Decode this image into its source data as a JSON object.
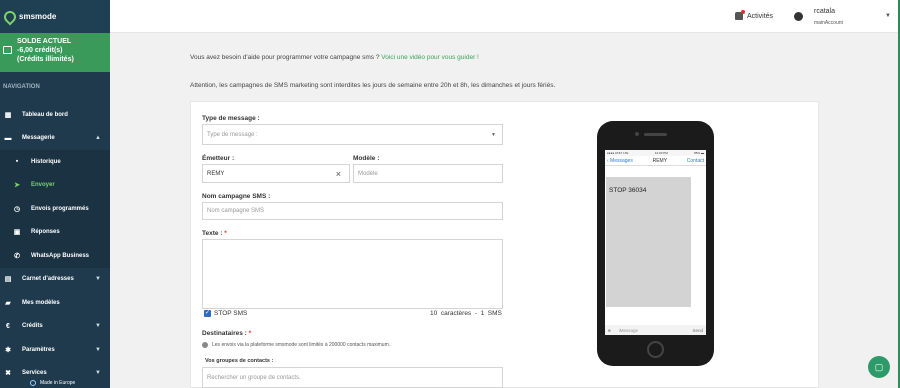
{
  "brand": {
    "name": "smsmode"
  },
  "balance": {
    "title": "SOLDE ACTUEL",
    "amount": "-6,00 crédit(s)",
    "note": "(Crédits illimités)"
  },
  "nav": {
    "heading": "NAVIGATION",
    "items": [
      {
        "label": "Tableau de bord",
        "icon": "dashboard-icon"
      },
      {
        "label": "Messagerie",
        "icon": "chat-icon",
        "chevron": "▲"
      },
      {
        "label": "Historique",
        "icon": "history-icon",
        "sub": true
      },
      {
        "label": "Envoyer",
        "icon": "send-icon",
        "sub": true,
        "active": true
      },
      {
        "label": "Envois programmés",
        "icon": "clock-icon",
        "sub": true
      },
      {
        "label": "Réponses",
        "icon": "inbox-icon",
        "sub": true
      },
      {
        "label": "WhatsApp Business",
        "icon": "phone-icon",
        "sub": true
      },
      {
        "label": "Carnet d'adresses",
        "icon": "addressbook-icon",
        "chevron": "▼"
      },
      {
        "label": "Mes modèles",
        "icon": "templates-icon"
      },
      {
        "label": "Crédits",
        "icon": "euro-icon",
        "chevron": "▼"
      },
      {
        "label": "Paramètres",
        "icon": "gear-icon",
        "chevron": "▼"
      },
      {
        "label": "Services",
        "icon": "tools-icon",
        "chevron": "▼"
      }
    ],
    "made_in": "Made in Europe"
  },
  "header": {
    "activities": "Activités",
    "user_name": "rcatala",
    "user_account": "mainAccount"
  },
  "help": {
    "text": "Vous avez besoin d'aide pour programmer votre campagne sms ? ",
    "link": "Voici une vidéo pour vous guider !"
  },
  "warning": "Attention, les campagnes de SMS marketing sont interdites les jours de semaine entre 20h et 8h, les dimanches et jours fériés.",
  "form": {
    "type_label": "Type de message :",
    "type_placeholder": "Type de message :",
    "sender_label": "Émetteur :",
    "sender_value": "REMY",
    "template_label": "Modèle :",
    "template_placeholder": "Modèle",
    "campaign_label": "Nom campagne SMS :",
    "campaign_placeholder": "Nom campagne SMS",
    "text_label": "Texte :",
    "required_mark": "*",
    "stop_label": "STOP SMS",
    "counter": "10  caractères  -  1  SMS",
    "recipients_label": "Destinataires :",
    "info": "Les envois via la plateforme smsmode sont limités à 200000 contacts maximum.",
    "groups_label": "Vos groupes de contacts :",
    "groups_placeholder": "Rechercher un groupe de contacts."
  },
  "preview": {
    "carrier": "●●●● AT&T LTE",
    "time": "12:00 PM",
    "battery": "85% ▬",
    "back": "‹ Messages",
    "sender": "REMY",
    "contact": "Contact",
    "message": "STOP 36034",
    "input_placeholder": "iMessage",
    "send": "Send"
  }
}
